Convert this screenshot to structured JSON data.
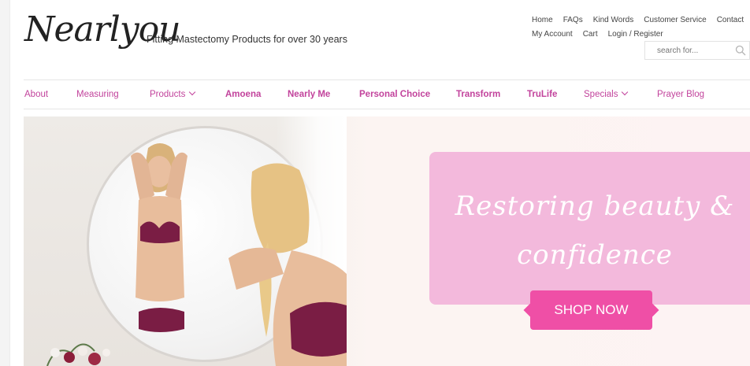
{
  "brand": {
    "logo_text": "Nearlyou",
    "tagline": "Fitting Mastectomy Products for over 30 years"
  },
  "top_links": {
    "row1": [
      "Home",
      "FAQs",
      "Kind Words",
      "Customer Service",
      "Contact"
    ],
    "row2": [
      "My Account",
      "Cart",
      "Login / Register"
    ]
  },
  "search": {
    "placeholder": "search for...",
    "icon": "search-icon"
  },
  "nav": {
    "items": [
      {
        "label": "About",
        "bold": false,
        "dropdown": false
      },
      {
        "label": "Measuring",
        "bold": false,
        "dropdown": false
      },
      {
        "label": "Products",
        "bold": false,
        "dropdown": true
      },
      {
        "label": "Amoena",
        "bold": true,
        "dropdown": false
      },
      {
        "label": "Nearly Me",
        "bold": true,
        "dropdown": false
      },
      {
        "label": "Personal Choice",
        "bold": true,
        "dropdown": false
      },
      {
        "label": "Transform",
        "bold": true,
        "dropdown": false
      },
      {
        "label": "TruLife",
        "bold": true,
        "dropdown": false
      },
      {
        "label": "Specials",
        "bold": false,
        "dropdown": true
      },
      {
        "label": "Prayer Blog",
        "bold": false,
        "dropdown": false
      }
    ]
  },
  "hero": {
    "headline_line1": "Restoring beauty &",
    "headline_line2": "confidence",
    "cta_label": "SHOP NOW"
  },
  "colors": {
    "accent": "#c2439c",
    "promo_bg": "#f3b9dc",
    "cta_bg": "#ef4fa6",
    "lingerie": "#7a1d44"
  }
}
